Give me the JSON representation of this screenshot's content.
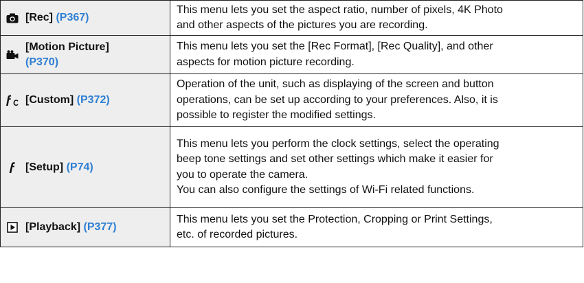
{
  "menus": [
    {
      "icon": "camera-icon",
      "name": "[Rec]",
      "page_ref": "(P367)",
      "description_lines": [
        "This menu lets you set the aspect ratio, number of pixels, 4K Photo",
        "and other aspects of the pictures you are recording."
      ]
    },
    {
      "icon": "movie-camera-icon",
      "name": "[Motion Picture]",
      "page_ref": "(P370)",
      "description_lines": [
        "This menu lets you set the [Rec Format], [Rec Quality], and other",
        "aspects for motion picture recording."
      ]
    },
    {
      "icon": "custom-wrench-icon",
      "name": "[Custom]",
      "page_ref": "(P372)",
      "description_lines": [
        "Operation of the unit, such as displaying of the screen and button",
        "operations, can be set up according to your preferences. Also, it is",
        "possible to register the modified settings."
      ]
    },
    {
      "icon": "wrench-icon",
      "name": "[Setup]",
      "page_ref": "(P74)",
      "description_lines": [
        "This menu lets you perform the clock settings, select the operating",
        "beep tone settings and set other settings which make it easier for",
        "you to operate the camera.",
        "You can also configure the settings of Wi-Fi related functions."
      ]
    },
    {
      "icon": "playback-icon",
      "name": "[Playback]",
      "page_ref": "(P377)",
      "description_lines": [
        "This menu lets you set the Protection, Cropping or Print Settings,",
        "etc. of recorded pictures."
      ]
    }
  ],
  "colors": {
    "page_ref": "#2e7fd3",
    "name_cell_bg": "#eeeeee",
    "border": "#222222"
  }
}
